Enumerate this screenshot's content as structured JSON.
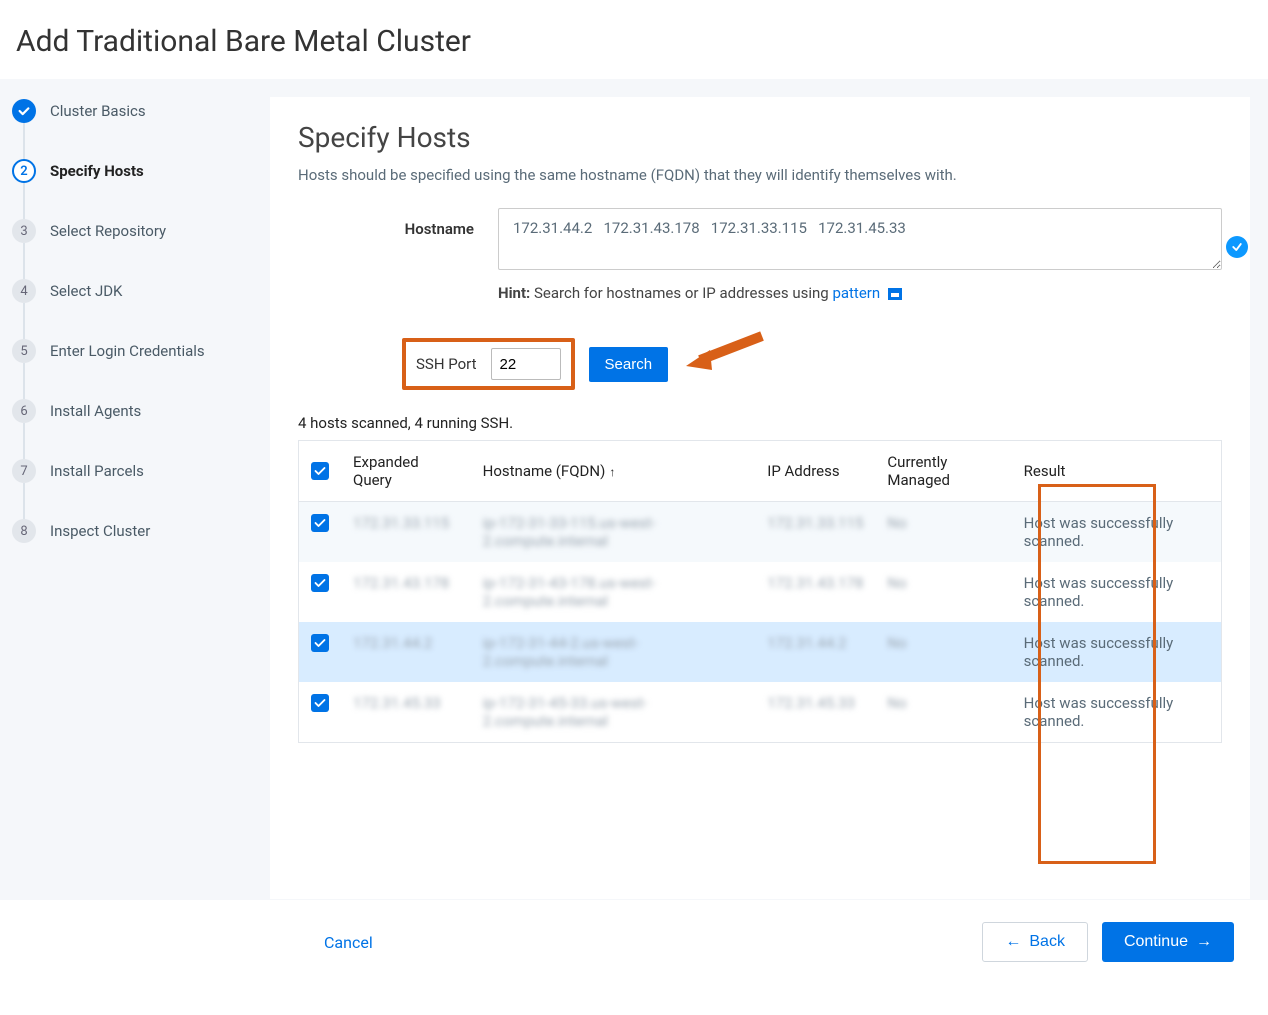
{
  "page_title": "Add Traditional Bare Metal Cluster",
  "steps": [
    {
      "n": "",
      "label": "Cluster Basics",
      "state": "done"
    },
    {
      "n": "2",
      "label": "Specify Hosts",
      "state": "current"
    },
    {
      "n": "3",
      "label": "Select Repository",
      "state": "pending"
    },
    {
      "n": "4",
      "label": "Select JDK",
      "state": "pending"
    },
    {
      "n": "5",
      "label": "Enter Login Credentials",
      "state": "pending"
    },
    {
      "n": "6",
      "label": "Install Agents",
      "state": "pending"
    },
    {
      "n": "7",
      "label": "Install Parcels",
      "state": "pending"
    },
    {
      "n": "8",
      "label": "Inspect Cluster",
      "state": "pending"
    }
  ],
  "panel": {
    "title": "Specify Hosts",
    "description": "Hosts should be specified using the same hostname (FQDN) that they will identify themselves with.",
    "hostname_label": "Hostname",
    "hostname_value": "172.31.44.2   172.31.43.178   172.31.33.115   172.31.45.33",
    "hint_bold": "Hint:",
    "hint_text": " Search for hostnames or IP addresses using ",
    "hint_link": "pattern",
    "ssh_label": "SSH Port",
    "ssh_value": "22",
    "search_label": "Search",
    "scan_status": "4 hosts scanned, 4 running SSH."
  },
  "table": {
    "columns": [
      "",
      "Expanded Query",
      "Hostname (FQDN)",
      "IP Address",
      "Currently Managed",
      "Result"
    ],
    "sort_col": 2,
    "rows": [
      {
        "checked": true,
        "query": "172.31.33.115",
        "fqdn": "ip-172-31-33-115.us-west-2.compute.internal",
        "ip": "172.31.33.115",
        "managed": "No",
        "result": "Host was successfully scanned.",
        "hover": false
      },
      {
        "checked": true,
        "query": "172.31.43.178",
        "fqdn": "ip-172-31-43-178.us-west-2.compute.internal",
        "ip": "172.31.43.178",
        "managed": "No",
        "result": "Host was successfully scanned.",
        "hover": false
      },
      {
        "checked": true,
        "query": "172.31.44.2",
        "fqdn": "ip-172-31-44-2.us-west-2.compute.internal",
        "ip": "172.31.44.2",
        "managed": "No",
        "result": "Host was successfully scanned.",
        "hover": true
      },
      {
        "checked": true,
        "query": "172.31.45.33",
        "fqdn": "ip-172-31-45-33.us-west-2.compute.internal",
        "ip": "172.31.45.33",
        "managed": "No",
        "result": "Host was successfully scanned.",
        "hover": false
      }
    ]
  },
  "footer": {
    "cancel": "Cancel",
    "back": "Back",
    "continue": "Continue"
  },
  "colors": {
    "accent": "#0073e6",
    "highlight_orange": "#d86018"
  }
}
